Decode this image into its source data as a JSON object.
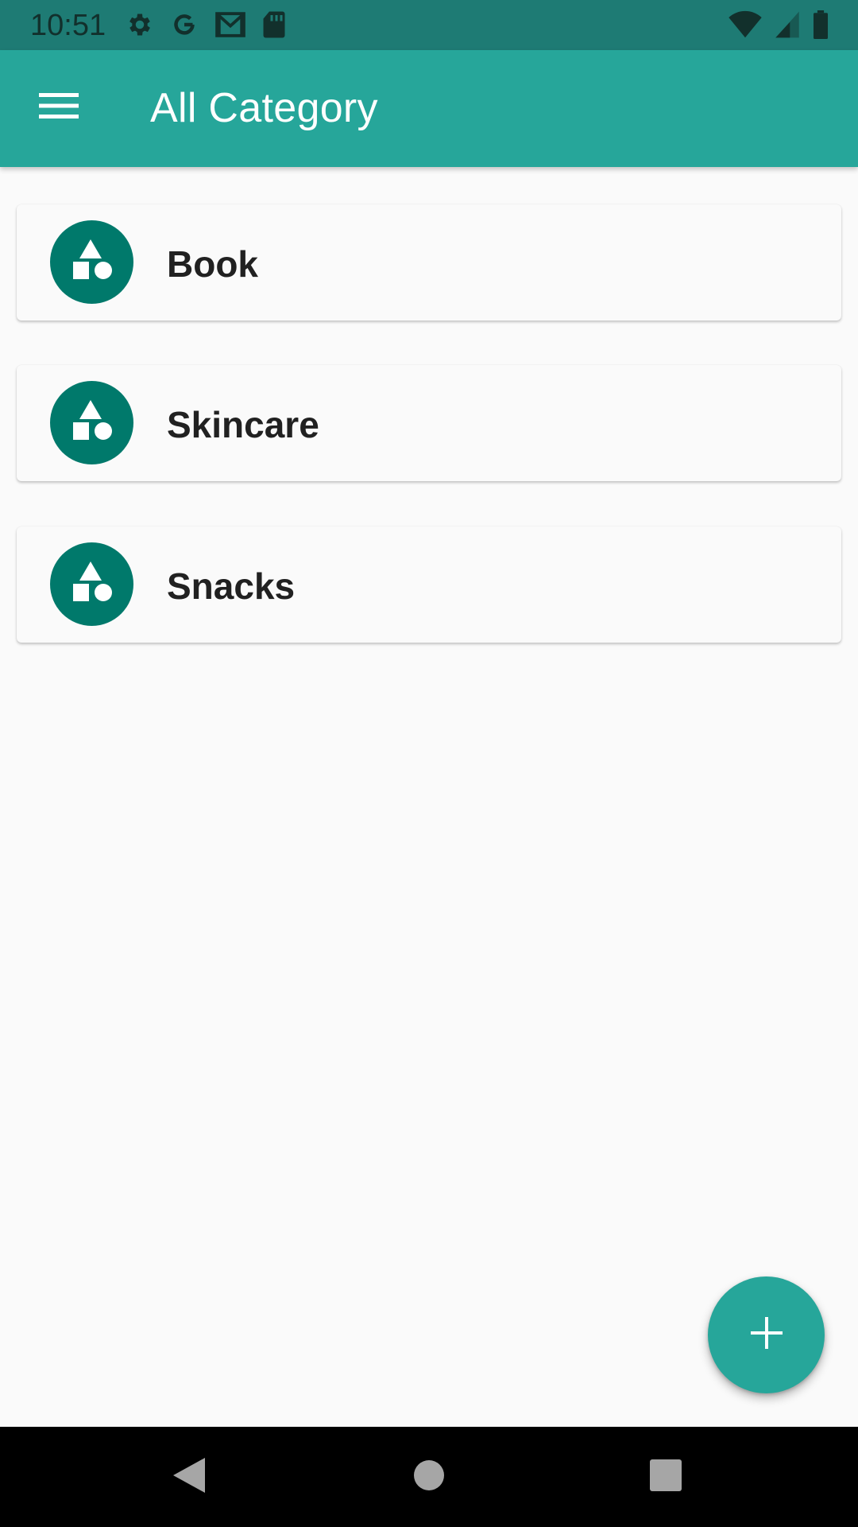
{
  "status_bar": {
    "time": "10:51",
    "left_icons": [
      "settings-icon",
      "google-icon",
      "gmail-icon",
      "sd-card-icon"
    ],
    "right_icons": [
      "wifi-icon",
      "cellular-signal-icon",
      "battery-icon"
    ]
  },
  "app_bar": {
    "title": "All Category",
    "menu_icon": "hamburger-menu-icon",
    "color": "#26a69a"
  },
  "categories": [
    {
      "name": "Book",
      "icon": "category-shapes-icon"
    },
    {
      "name": "Skincare",
      "icon": "category-shapes-icon"
    },
    {
      "name": "Snacks",
      "icon": "category-shapes-icon"
    }
  ],
  "fab": {
    "icon": "add-icon",
    "color": "#26a69a"
  },
  "nav_bar": {
    "buttons": [
      "back-icon",
      "home-icon",
      "recents-icon"
    ]
  },
  "colors": {
    "accent": "#26a69a",
    "avatar": "#00796b",
    "status_bar": "#1e7b74"
  }
}
